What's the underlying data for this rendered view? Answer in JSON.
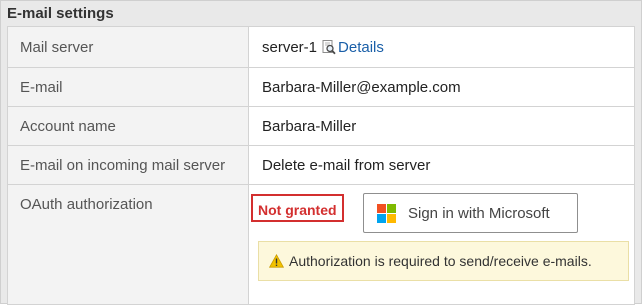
{
  "section": {
    "title": "E-mail settings"
  },
  "rows": {
    "mail_server": {
      "label": "Mail server",
      "value": "server-1",
      "details_link": "Details",
      "icon": "magnifier-document-icon"
    },
    "email": {
      "label": "E-mail",
      "value": "Barbara-Miller@example.com"
    },
    "account_name": {
      "label": "Account name",
      "value": "Barbara-Miller"
    },
    "incoming": {
      "label": "E-mail on incoming mail server",
      "value": "Delete e-mail from server"
    },
    "oauth": {
      "label": "OAuth authorization",
      "status": "Not granted",
      "status_color": "#d32f2f",
      "signin_button": "Sign in with Microsoft",
      "signin_icon": "microsoft-logo-icon",
      "warning": "Authorization is required to send/receive e-mails.",
      "warning_icon": "warning-triangle-icon"
    }
  },
  "colors": {
    "link": "#1a5fa8",
    "warning_bg": "#fdf8dc",
    "ms_red": "#f25022",
    "ms_green": "#7fba00",
    "ms_blue": "#00a4ef",
    "ms_yellow": "#ffb900"
  }
}
